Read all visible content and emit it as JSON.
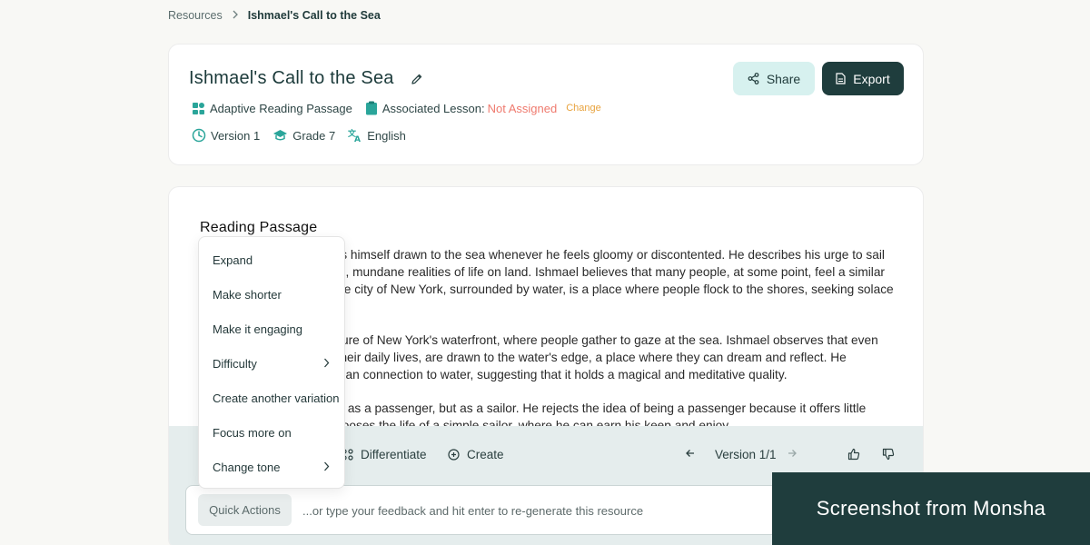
{
  "breadcrumb": {
    "root": "Resources",
    "current": "Ishmael's Call to the Sea"
  },
  "header": {
    "title": "Ishmael's Call to the Sea",
    "resource_type": "Adaptive Reading Passage",
    "associated_lesson_label": "Associated Lesson:",
    "associated_lesson_value": "Not Assigned",
    "change_label": "Change",
    "version": "Version 1",
    "grade": "Grade 7",
    "language": "English",
    "share_label": "Share",
    "export_label": "Export"
  },
  "passage": {
    "title": "Reading Passage",
    "paragraphs": [
      "Ishmael, the narrator, finds himself drawn to the sea whenever he feels gloomy or discontented. He describes his urge to sail as an escape from the dull, mundane realities of life on land. Ishmael believes that many people, at some point, feel a similar attraction to the ocean. The city of New York, surrounded by water, is a place where people flock to the shores, seeking solace and peace.",
      "Ishmael paints a vivid picture of New York's waterfront, where people gather to gaze at the sea. Ishmael observes that even those who are busy with their daily lives, are drawn to the water's edge, a place where they can dream and reflect. He emphasizes the deep human connection to water, suggesting that it holds a magical and meditative quality.",
      "Ishmael goes to sea is not as a passenger, but as a sailor. He rejects the idea of being a passenger because it offers little enjoyment. Instead, he chooses the life of a simple sailor, where he can earn his keep and enjoy"
    ]
  },
  "toolbar": {
    "differentiate_label": "Differentiate",
    "create_label": "Create",
    "version_label": "Version 1/1"
  },
  "input": {
    "quick_actions_label": "Quick Actions",
    "placeholder": "...or type your feedback and hit enter to re-generate this resource"
  },
  "menu": {
    "items": [
      {
        "label": "Expand",
        "submenu": false
      },
      {
        "label": "Make shorter",
        "submenu": false
      },
      {
        "label": "Make it engaging",
        "submenu": false
      },
      {
        "label": "Difficulty",
        "submenu": true
      },
      {
        "label": "Create another variation",
        "submenu": false
      },
      {
        "label": "Focus more on",
        "submenu": false
      },
      {
        "label": "Change tone",
        "submenu": true
      }
    ]
  },
  "watermark": {
    "text": "Screenshot from Monsha"
  },
  "colors": {
    "primary": "#1f3d3d",
    "accent_light": "#d7f1ef",
    "not_assigned": "#ef7a6e",
    "change": "#e8a23c",
    "toolbar_bg": "#e5eded"
  }
}
